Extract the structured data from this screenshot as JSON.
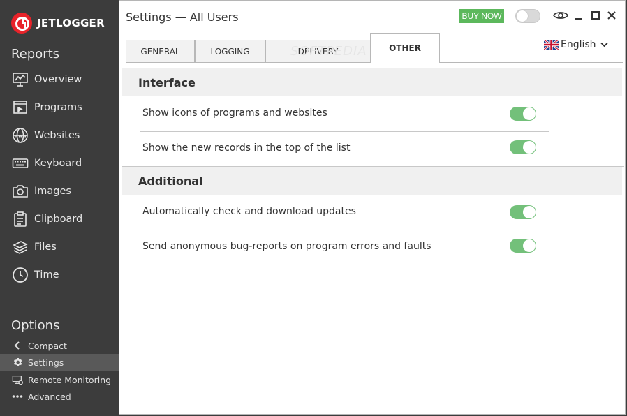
{
  "app": {
    "logo_text": "JETLOGGER",
    "title": "Settings — All Users",
    "buy_now": "BUY NOW"
  },
  "colors": {
    "accent_red": "#e8232a",
    "toggle_green": "#73c07a",
    "buy_green": "#5cb85c",
    "sidebar_bg": "#3c3c3c",
    "active_item": "#595959"
  },
  "sidebar": {
    "reports_title": "Reports",
    "reports": [
      {
        "label": "Overview",
        "icon": "chart-board-icon"
      },
      {
        "label": "Programs",
        "icon": "program-window-icon"
      },
      {
        "label": "Websites",
        "icon": "www-globe-icon"
      },
      {
        "label": "Keyboard",
        "icon": "keyboard-icon"
      },
      {
        "label": "Images",
        "icon": "camera-icon"
      },
      {
        "label": "Clipboard",
        "icon": "clipboard-icon"
      },
      {
        "label": "Files",
        "icon": "files-stack-icon"
      },
      {
        "label": "Time",
        "icon": "clock-icon"
      }
    ],
    "options_title": "Options",
    "options": [
      {
        "label": "Compact",
        "icon": "chevron-left-icon"
      },
      {
        "label": "Settings",
        "icon": "gear-icon",
        "active": true
      },
      {
        "label": "Remote Monitoring",
        "icon": "remote-monitor-icon"
      },
      {
        "label": "Advanced",
        "icon": "more-dots-icon"
      }
    ]
  },
  "tabs": [
    {
      "label": "GENERAL"
    },
    {
      "label": "LOGGING"
    },
    {
      "label": "DELIVERY"
    },
    {
      "label": "OTHER",
      "active": true
    }
  ],
  "language": {
    "selected": "English",
    "icon": "uk-flag-icon"
  },
  "watermark": "SOFTPEDIA",
  "sections": [
    {
      "title": "Interface",
      "items": [
        {
          "label": "Show icons of programs and websites",
          "enabled": true
        },
        {
          "label": "Show the new records in the top of the list",
          "enabled": true
        }
      ]
    },
    {
      "title": "Additional",
      "items": [
        {
          "label": "Automatically check and download updates",
          "enabled": true
        },
        {
          "label": "Send anonymous bug-reports on program errors and faults",
          "enabled": true
        }
      ]
    }
  ]
}
